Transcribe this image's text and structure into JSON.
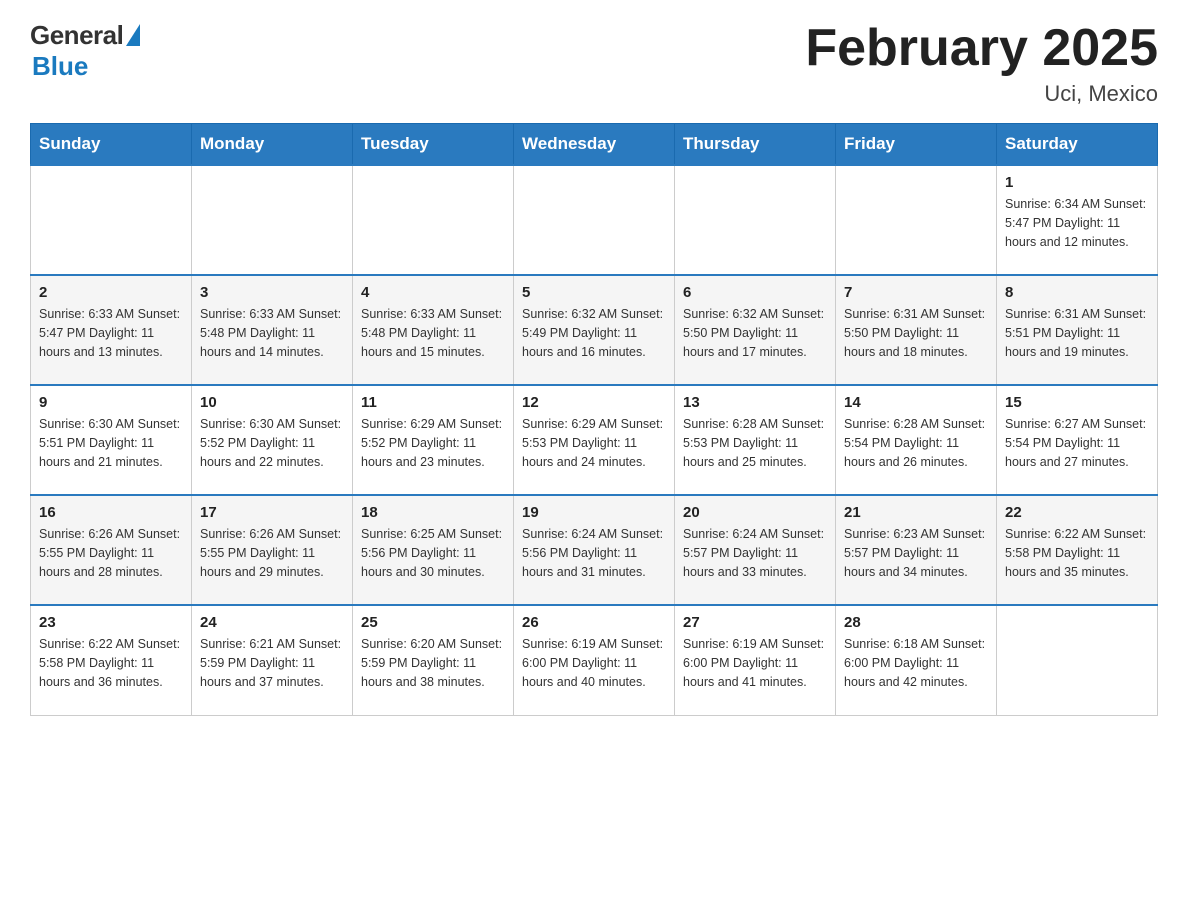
{
  "header": {
    "logo_general": "General",
    "logo_blue": "Blue",
    "month_title": "February 2025",
    "location": "Uci, Mexico"
  },
  "days_of_week": [
    "Sunday",
    "Monday",
    "Tuesday",
    "Wednesday",
    "Thursday",
    "Friday",
    "Saturday"
  ],
  "weeks": [
    {
      "days": [
        {
          "date": "",
          "info": ""
        },
        {
          "date": "",
          "info": ""
        },
        {
          "date": "",
          "info": ""
        },
        {
          "date": "",
          "info": ""
        },
        {
          "date": "",
          "info": ""
        },
        {
          "date": "",
          "info": ""
        },
        {
          "date": "1",
          "info": "Sunrise: 6:34 AM\nSunset: 5:47 PM\nDaylight: 11 hours and 12 minutes."
        }
      ]
    },
    {
      "days": [
        {
          "date": "2",
          "info": "Sunrise: 6:33 AM\nSunset: 5:47 PM\nDaylight: 11 hours and 13 minutes."
        },
        {
          "date": "3",
          "info": "Sunrise: 6:33 AM\nSunset: 5:48 PM\nDaylight: 11 hours and 14 minutes."
        },
        {
          "date": "4",
          "info": "Sunrise: 6:33 AM\nSunset: 5:48 PM\nDaylight: 11 hours and 15 minutes."
        },
        {
          "date": "5",
          "info": "Sunrise: 6:32 AM\nSunset: 5:49 PM\nDaylight: 11 hours and 16 minutes."
        },
        {
          "date": "6",
          "info": "Sunrise: 6:32 AM\nSunset: 5:50 PM\nDaylight: 11 hours and 17 minutes."
        },
        {
          "date": "7",
          "info": "Sunrise: 6:31 AM\nSunset: 5:50 PM\nDaylight: 11 hours and 18 minutes."
        },
        {
          "date": "8",
          "info": "Sunrise: 6:31 AM\nSunset: 5:51 PM\nDaylight: 11 hours and 19 minutes."
        }
      ]
    },
    {
      "days": [
        {
          "date": "9",
          "info": "Sunrise: 6:30 AM\nSunset: 5:51 PM\nDaylight: 11 hours and 21 minutes."
        },
        {
          "date": "10",
          "info": "Sunrise: 6:30 AM\nSunset: 5:52 PM\nDaylight: 11 hours and 22 minutes."
        },
        {
          "date": "11",
          "info": "Sunrise: 6:29 AM\nSunset: 5:52 PM\nDaylight: 11 hours and 23 minutes."
        },
        {
          "date": "12",
          "info": "Sunrise: 6:29 AM\nSunset: 5:53 PM\nDaylight: 11 hours and 24 minutes."
        },
        {
          "date": "13",
          "info": "Sunrise: 6:28 AM\nSunset: 5:53 PM\nDaylight: 11 hours and 25 minutes."
        },
        {
          "date": "14",
          "info": "Sunrise: 6:28 AM\nSunset: 5:54 PM\nDaylight: 11 hours and 26 minutes."
        },
        {
          "date": "15",
          "info": "Sunrise: 6:27 AM\nSunset: 5:54 PM\nDaylight: 11 hours and 27 minutes."
        }
      ]
    },
    {
      "days": [
        {
          "date": "16",
          "info": "Sunrise: 6:26 AM\nSunset: 5:55 PM\nDaylight: 11 hours and 28 minutes."
        },
        {
          "date": "17",
          "info": "Sunrise: 6:26 AM\nSunset: 5:55 PM\nDaylight: 11 hours and 29 minutes."
        },
        {
          "date": "18",
          "info": "Sunrise: 6:25 AM\nSunset: 5:56 PM\nDaylight: 11 hours and 30 minutes."
        },
        {
          "date": "19",
          "info": "Sunrise: 6:24 AM\nSunset: 5:56 PM\nDaylight: 11 hours and 31 minutes."
        },
        {
          "date": "20",
          "info": "Sunrise: 6:24 AM\nSunset: 5:57 PM\nDaylight: 11 hours and 33 minutes."
        },
        {
          "date": "21",
          "info": "Sunrise: 6:23 AM\nSunset: 5:57 PM\nDaylight: 11 hours and 34 minutes."
        },
        {
          "date": "22",
          "info": "Sunrise: 6:22 AM\nSunset: 5:58 PM\nDaylight: 11 hours and 35 minutes."
        }
      ]
    },
    {
      "days": [
        {
          "date": "23",
          "info": "Sunrise: 6:22 AM\nSunset: 5:58 PM\nDaylight: 11 hours and 36 minutes."
        },
        {
          "date": "24",
          "info": "Sunrise: 6:21 AM\nSunset: 5:59 PM\nDaylight: 11 hours and 37 minutes."
        },
        {
          "date": "25",
          "info": "Sunrise: 6:20 AM\nSunset: 5:59 PM\nDaylight: 11 hours and 38 minutes."
        },
        {
          "date": "26",
          "info": "Sunrise: 6:19 AM\nSunset: 6:00 PM\nDaylight: 11 hours and 40 minutes."
        },
        {
          "date": "27",
          "info": "Sunrise: 6:19 AM\nSunset: 6:00 PM\nDaylight: 11 hours and 41 minutes."
        },
        {
          "date": "28",
          "info": "Sunrise: 6:18 AM\nSunset: 6:00 PM\nDaylight: 11 hours and 42 minutes."
        },
        {
          "date": "",
          "info": ""
        }
      ]
    }
  ]
}
